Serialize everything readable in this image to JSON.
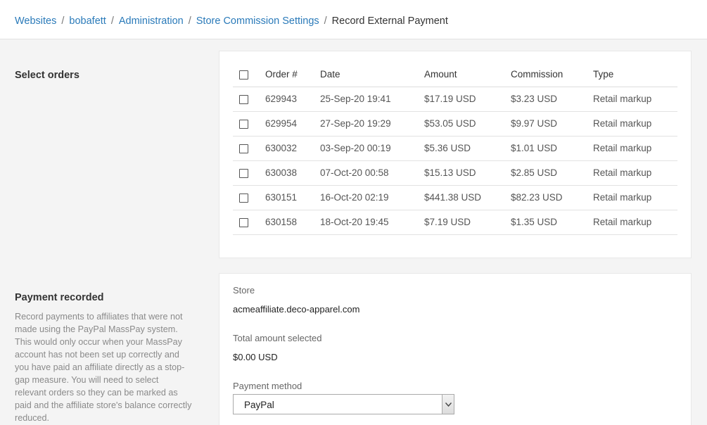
{
  "breadcrumb": {
    "items": [
      "Websites",
      "bobafett",
      "Administration",
      "Store Commission Settings"
    ],
    "current": "Record External Payment",
    "separator": "/"
  },
  "select_orders": {
    "title": "Select orders",
    "columns": [
      "Order #",
      "Date",
      "Amount",
      "Commission",
      "Type"
    ],
    "rows": [
      {
        "order": "629943",
        "date": "25-Sep-20 19:41",
        "amount": "$17.19 USD",
        "commission": "$3.23 USD",
        "type": "Retail markup"
      },
      {
        "order": "629954",
        "date": "27-Sep-20 19:29",
        "amount": "$53.05 USD",
        "commission": "$9.97 USD",
        "type": "Retail markup"
      },
      {
        "order": "630032",
        "date": "03-Sep-20 00:19",
        "amount": "$5.36 USD",
        "commission": "$1.01 USD",
        "type": "Retail markup"
      },
      {
        "order": "630038",
        "date": "07-Oct-20 00:58",
        "amount": "$15.13 USD",
        "commission": "$2.85 USD",
        "type": "Retail markup"
      },
      {
        "order": "630151",
        "date": "16-Oct-20 02:19",
        "amount": "$441.38 USD",
        "commission": "$82.23 USD",
        "type": "Retail markup"
      },
      {
        "order": "630158",
        "date": "18-Oct-20 19:45",
        "amount": "$7.19 USD",
        "commission": "$1.35 USD",
        "type": "Retail markup"
      }
    ]
  },
  "payment": {
    "title": "Payment recorded",
    "help": "Record payments to affiliates that were not made using the PayPal MassPay system. This would only occur when your MassPay account has not been set up correctly and you have paid an affiliate directly as a stop-gap measure. You will need to select relevant orders so they can be marked as paid and the affiliate store's balance correctly reduced.",
    "store_label": "Store",
    "store_value": "acmeaffiliate.deco-apparel.com",
    "total_label": "Total amount selected",
    "total_value": "$0.00 USD",
    "method_label": "Payment method",
    "method_value": "PayPal"
  },
  "icons": {
    "select_arrow": "chevron-down-icon",
    "checkbox": "checkbox-unchecked"
  },
  "colors": {
    "link": "#2a7ab9",
    "background": "#f4f4f4",
    "card": "#ffffff"
  }
}
